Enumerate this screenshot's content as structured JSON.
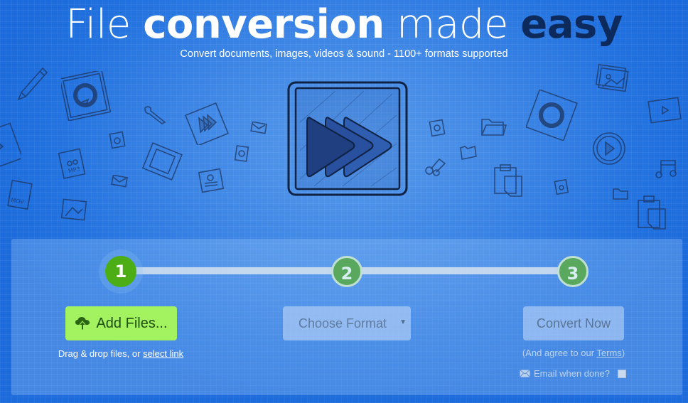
{
  "hero": {
    "title_parts": [
      "File",
      "conversion",
      "made",
      "easy"
    ],
    "subtitle": "Convert documents, images, videos & sound - 1100+ formats supported"
  },
  "colors": {
    "accent_dark": "#0d2a5c",
    "add_button": "#a3f25f",
    "step_active": "#4cae14",
    "step_pending": "#5aa85e"
  },
  "decorations": [
    "pencil-icon",
    "refresh-icon",
    "wrench-icon",
    "fast-forward-icon",
    "envelope-icon",
    "audio-file-icon",
    "mp3-file-icon",
    "film-strip-icon",
    "contact-card-icon",
    "mov-file-icon",
    "image-file-icon",
    "folder-icon",
    "music-note-icon",
    "clipboard-icon",
    "play-circle-icon",
    "video-file-icon",
    "gallery-icon"
  ],
  "steps": [
    {
      "number": "1",
      "state": "active"
    },
    {
      "number": "2",
      "state": "pending"
    },
    {
      "number": "3",
      "state": "pending"
    }
  ],
  "add_files": {
    "label": "Add Files...",
    "icon": "cloud-upload-icon",
    "hint_prefix": "Drag & drop files, or ",
    "hint_link": "select link"
  },
  "format": {
    "selected": "Choose Format"
  },
  "convert": {
    "label": "Convert Now",
    "terms_prefix": "(And agree to our ",
    "terms_link": "Terms",
    "terms_suffix": ")",
    "email_label": "Email when done?",
    "email_checked": false
  }
}
